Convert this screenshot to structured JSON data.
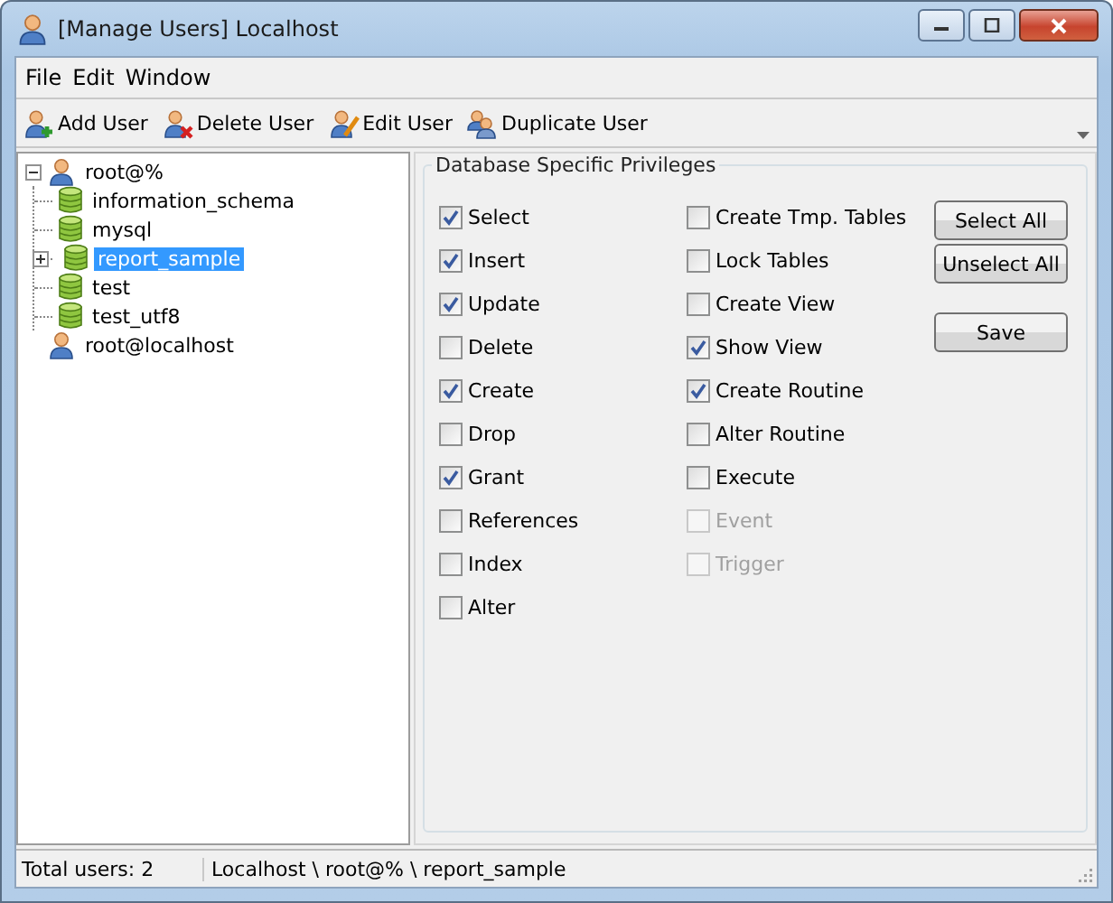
{
  "window": {
    "title": "[Manage Users] Localhost"
  },
  "menu": [
    "File",
    "Edit",
    "Window"
  ],
  "toolbar": [
    {
      "label": "Add User",
      "kind": "add"
    },
    {
      "label": "Delete User",
      "kind": "delete"
    },
    {
      "label": "Edit User",
      "kind": "edit"
    },
    {
      "label": "Duplicate User",
      "kind": "duplicate"
    }
  ],
  "tree": [
    {
      "label": "root@%",
      "kind": "user",
      "selected": false,
      "expanded": true,
      "children": [
        {
          "label": "information_schema",
          "kind": "database",
          "selected": false
        },
        {
          "label": "mysql",
          "kind": "database",
          "selected": false
        },
        {
          "label": "report_sample",
          "kind": "database",
          "selected": true,
          "expanded": false
        },
        {
          "label": "test",
          "kind": "database",
          "selected": false
        },
        {
          "label": "test_utf8",
          "kind": "database",
          "selected": false
        }
      ]
    },
    {
      "label": "root@localhost",
      "kind": "user",
      "selected": false
    }
  ],
  "privileges": {
    "title": "Database Specific Privileges",
    "columns": [
      [
        {
          "label": "Select",
          "checked": true,
          "disabled": false
        },
        {
          "label": "Insert",
          "checked": true,
          "disabled": false
        },
        {
          "label": "Update",
          "checked": true,
          "disabled": false
        },
        {
          "label": "Delete",
          "checked": false,
          "disabled": false
        },
        {
          "label": "Create",
          "checked": true,
          "disabled": false
        },
        {
          "label": "Drop",
          "checked": false,
          "disabled": false
        },
        {
          "label": "Grant",
          "checked": true,
          "disabled": false
        },
        {
          "label": "References",
          "checked": false,
          "disabled": false
        },
        {
          "label": "Index",
          "checked": false,
          "disabled": false
        },
        {
          "label": "Alter",
          "checked": false,
          "disabled": false
        }
      ],
      [
        {
          "label": "Create Tmp. Tables",
          "checked": false,
          "disabled": false
        },
        {
          "label": "Lock Tables",
          "checked": false,
          "disabled": false
        },
        {
          "label": "Create View",
          "checked": false,
          "disabled": false
        },
        {
          "label": "Show View",
          "checked": true,
          "disabled": false
        },
        {
          "label": "Create Routine",
          "checked": true,
          "disabled": false
        },
        {
          "label": "Alter Routine",
          "checked": false,
          "disabled": false
        },
        {
          "label": "Execute",
          "checked": false,
          "disabled": false
        },
        {
          "label": "Event",
          "checked": false,
          "disabled": true
        },
        {
          "label": "Trigger",
          "checked": false,
          "disabled": true
        }
      ]
    ]
  },
  "buttons": [
    "Select All",
    "Unselect All",
    "Save"
  ],
  "status_bar": {
    "total": "Total users: 2",
    "path": "Localhost \\ root@% \\ report_sample"
  }
}
